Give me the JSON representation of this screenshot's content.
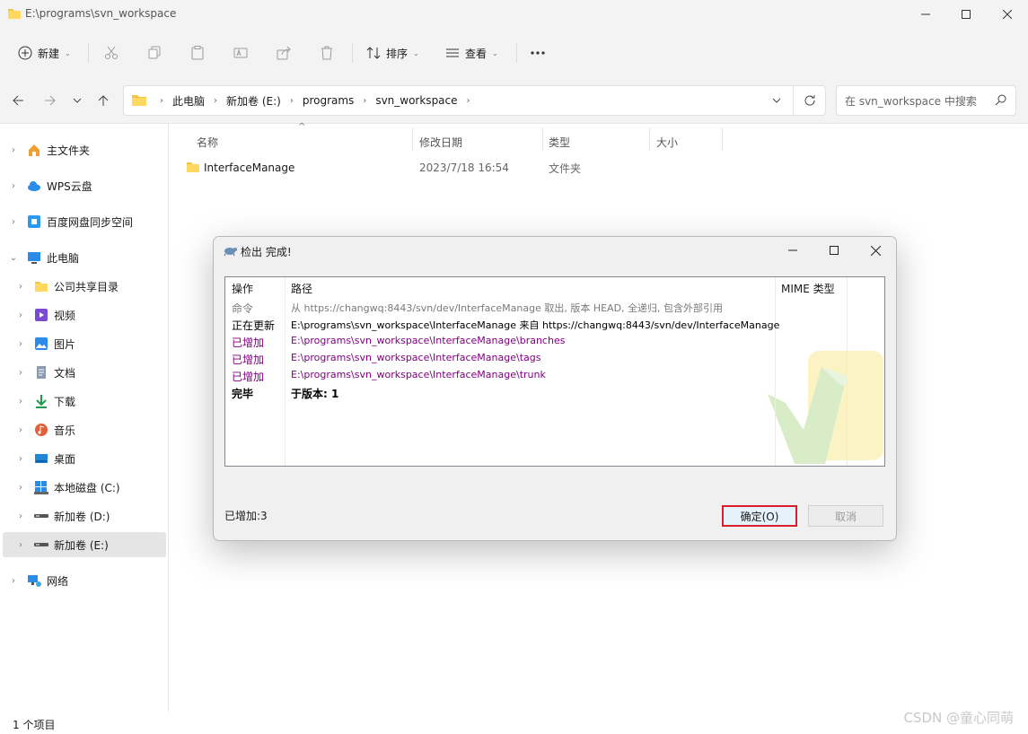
{
  "window": {
    "title": "E:\\programs\\svn_workspace"
  },
  "toolbar": {
    "new_label": "新建",
    "sort_label": "排序",
    "view_label": "查看"
  },
  "address": {
    "crumbs": [
      "此电脑",
      "新加卷 (E:)",
      "programs",
      "svn_workspace"
    ],
    "search_placeholder": "在 svn_workspace 中搜索"
  },
  "sidebar": {
    "items": [
      {
        "label": "主文件夹"
      },
      {
        "label": "WPS云盘"
      },
      {
        "label": "百度网盘同步空间"
      },
      {
        "label": "此电脑"
      },
      {
        "label": "公司共享目录"
      },
      {
        "label": "视频"
      },
      {
        "label": "图片"
      },
      {
        "label": "文档"
      },
      {
        "label": "下载"
      },
      {
        "label": "音乐"
      },
      {
        "label": "桌面"
      },
      {
        "label": "本地磁盘 (C:)"
      },
      {
        "label": "新加卷 (D:)"
      },
      {
        "label": "新加卷 (E:)"
      },
      {
        "label": "网络"
      }
    ]
  },
  "files": {
    "columns": {
      "name": "名称",
      "date": "修改日期",
      "type": "类型",
      "size": "大小"
    },
    "rows": [
      {
        "name": "InterfaceManage",
        "date": "2023/7/18 16:54",
        "type": "文件夹",
        "size": ""
      }
    ]
  },
  "statusbar": {
    "count": "1 个项目"
  },
  "dialog": {
    "title": "检出 完成!",
    "columns": {
      "action": "操作",
      "path": "路径",
      "mime": "MIME 类型"
    },
    "rows": [
      {
        "action": "命令",
        "path": "从 https://changwq:8443/svn/dev/InterfaceManage 取出, 版本 HEAD, 全递归, 包含外部引用"
      },
      {
        "action": "正在更新",
        "path": "E:\\programs\\svn_workspace\\InterfaceManage 来自 https://changwq:8443/svn/dev/InterfaceManage"
      },
      {
        "action": "已增加",
        "path": "E:\\programs\\svn_workspace\\InterfaceManage\\branches"
      },
      {
        "action": "已增加",
        "path": "E:\\programs\\svn_workspace\\InterfaceManage\\tags"
      },
      {
        "action": "已增加",
        "path": "E:\\programs\\svn_workspace\\InterfaceManage\\trunk"
      },
      {
        "action": "完毕",
        "path": "于版本: 1"
      }
    ],
    "status": "已增加:3",
    "ok_label": "确定(O)",
    "cancel_label": "取消"
  },
  "watermark": "CSDN @童心同萌"
}
